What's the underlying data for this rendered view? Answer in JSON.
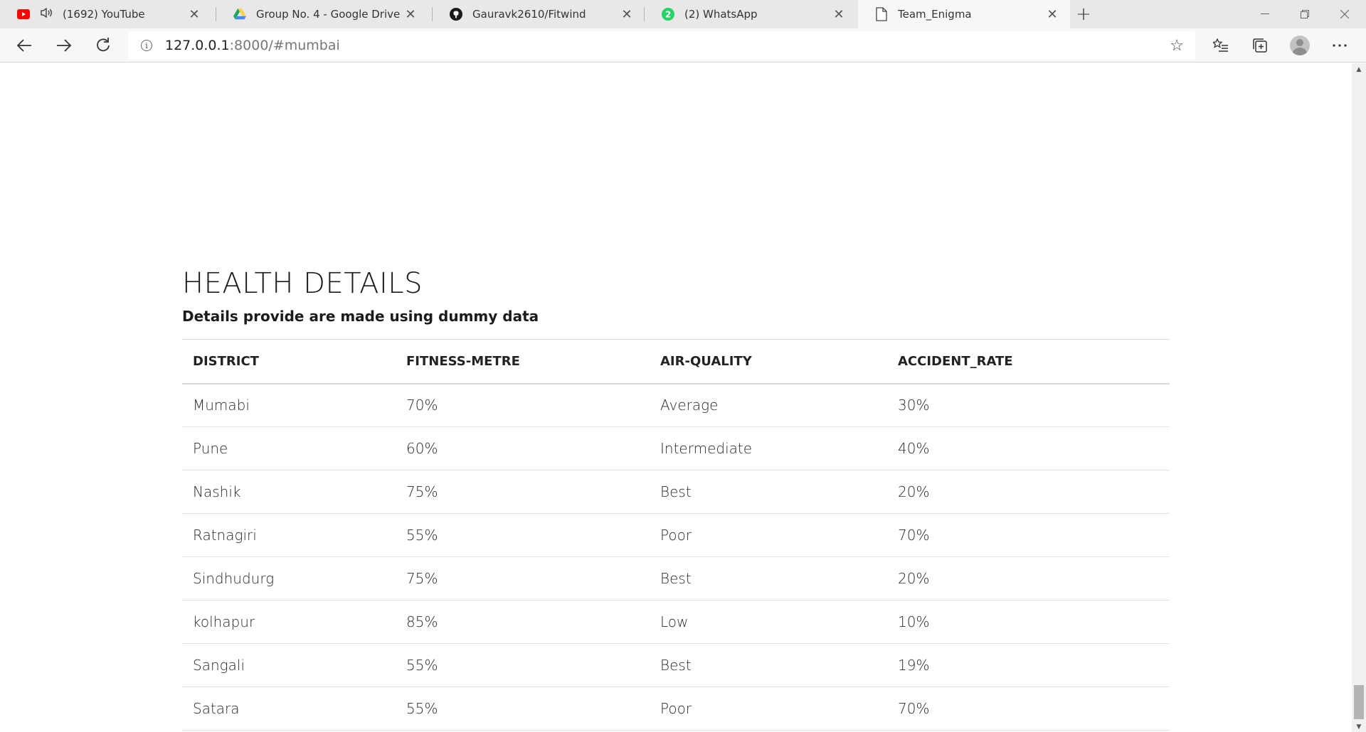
{
  "browser": {
    "tabs": [
      {
        "title": "(1692) YouTube",
        "icon": "youtube-icon",
        "audio": true,
        "active": false
      },
      {
        "title": "Group No. 4 - Google Drive",
        "icon": "google-drive-icon",
        "audio": false,
        "active": false
      },
      {
        "title": "Gauravk2610/Fitwind",
        "icon": "github-icon",
        "audio": false,
        "active": false
      },
      {
        "title": "(2) WhatsApp",
        "icon": "whatsapp-icon",
        "audio": false,
        "active": false
      },
      {
        "title": "Team_Enigma",
        "icon": "document-icon",
        "audio": false,
        "active": true
      }
    ],
    "whatsapp_badge": "2",
    "address_host": "127.0.0.1",
    "address_rest": ":8000/#mumbai"
  },
  "page": {
    "heading": "HEALTH DETAILS",
    "subheading": "Details provide are made using dummy data",
    "table": {
      "headers": [
        "DISTRICT",
        "FITNESS-METRE",
        "AIR-QUALITY",
        "ACCIDENT_RATE"
      ],
      "rows": [
        [
          "Mumabi",
          "70%",
          "Average",
          "30%"
        ],
        [
          "Pune",
          "60%",
          "Intermediate",
          "40%"
        ],
        [
          "Nashik",
          "75%",
          "Best",
          "20%"
        ],
        [
          "Ratnagiri",
          "55%",
          "Poor",
          "70%"
        ],
        [
          "Sindhudurg",
          "75%",
          "Best",
          "20%"
        ],
        [
          "kolhapur",
          "85%",
          "Low",
          "10%"
        ],
        [
          "Sangali",
          "55%",
          "Best",
          "19%"
        ],
        [
          "Satara",
          "55%",
          "Poor",
          "70%"
        ]
      ]
    }
  },
  "colors": {
    "youtube": "#ff0000",
    "whatsapp": "#25d366",
    "drive_green": "#1fa463",
    "drive_yellow": "#ffd04b",
    "drive_blue": "#4688f4"
  }
}
